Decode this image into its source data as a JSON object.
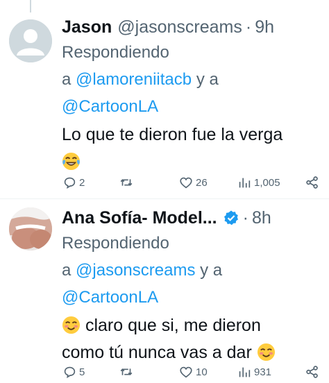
{
  "tweets": [
    {
      "name": "Jason",
      "handle": "@jasonscreams",
      "dot": "·",
      "time": "9h",
      "replying_label": "Respondiendo",
      "reply_prefix": "a",
      "mention_1": "@lamoreniitacb",
      "reply_join": "y a",
      "mention_2": "@CartoonLA",
      "text": "Lo que te dieron fue la verga",
      "emoji": "laughing-with-tears",
      "replies": "2",
      "retweets": "",
      "likes": "26",
      "views": "1,005"
    },
    {
      "name": "Ana Sofía- Model...",
      "verified": true,
      "dot": "·",
      "time": "8h",
      "replying_label": "Respondiendo",
      "reply_prefix": "a",
      "mention_1": "@jasonscreams",
      "reply_join": "y a",
      "mention_2": "@CartoonLA",
      "text_line_1": "claro que si, me dieron",
      "text_line_2": "como tú nunca vas a dar",
      "emoji": "smiling-face",
      "replies": "5",
      "retweets": "",
      "likes": "10",
      "views": "931"
    }
  ],
  "colors": {
    "text": "#0f1419",
    "secondary": "#536471",
    "link": "#1d9bf0",
    "verified": "#1d9bf0"
  }
}
